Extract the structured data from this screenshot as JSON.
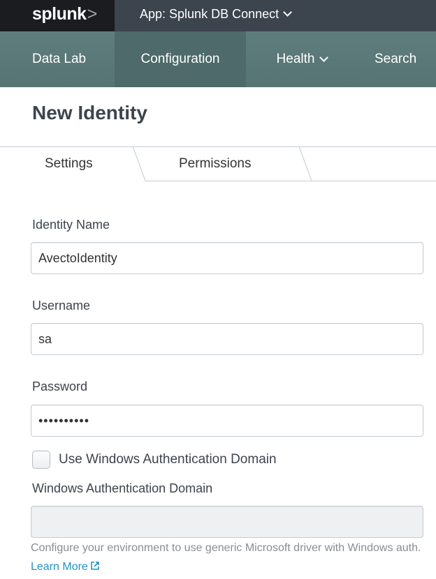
{
  "topbar": {
    "logo_text": "splunk",
    "logo_chevron": ">",
    "app_menu_label": "App: Splunk DB Connect"
  },
  "nav": {
    "items": [
      {
        "label": "Data Lab"
      },
      {
        "label": "Configuration"
      },
      {
        "label": "Health"
      },
      {
        "label": "Search"
      }
    ],
    "active_index": 1
  },
  "page": {
    "title": "New Identity"
  },
  "tabs": [
    {
      "label": "Settings"
    },
    {
      "label": "Permissions"
    }
  ],
  "form": {
    "identity_name": {
      "label": "Identity Name",
      "value": "AvectoIdentity"
    },
    "username": {
      "label": "Username",
      "value": "sa"
    },
    "password": {
      "label": "Password",
      "value": "••••••••••"
    },
    "use_windows_auth": {
      "label": "Use Windows Authentication Domain",
      "checked": false
    },
    "windows_domain": {
      "label": "Windows Authentication Domain",
      "value": ""
    },
    "help_text": "Configure your environment to use generic Microsoft driver with Windows auth.",
    "learn_more_label": "Learn More"
  },
  "colors": {
    "topbar": "#3c444d",
    "topbar_left": "#1a1c20",
    "navbar": "#5c7a7a",
    "navbar_active": "#4e6a6a",
    "link": "#1e93c6"
  }
}
